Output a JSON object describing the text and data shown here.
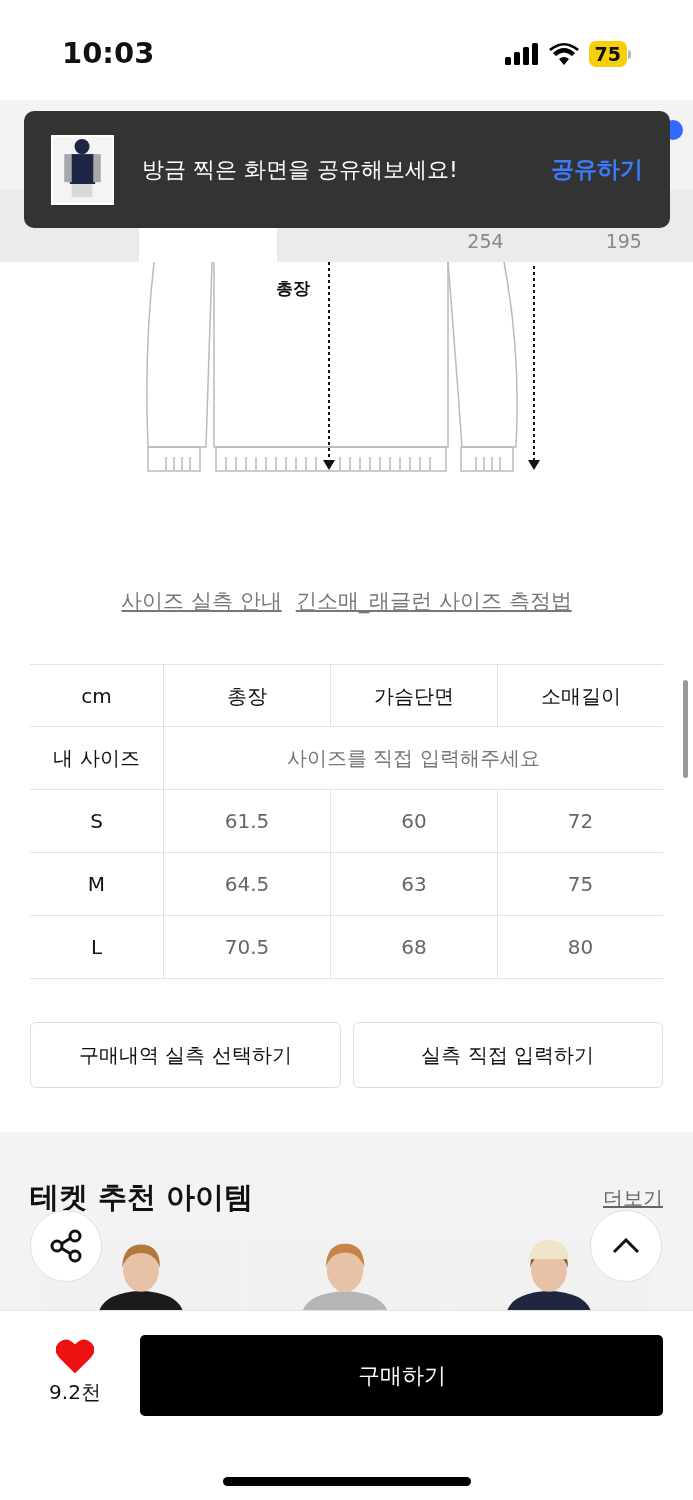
{
  "status_bar": {
    "time": "10:03",
    "battery": "75"
  },
  "toast": {
    "message": "방금 찍은 화면을 공유해보세요!",
    "action": "공유하기"
  },
  "tabs": [
    {
      "selected": true
    },
    {
      "selected": false,
      "count": "254"
    },
    {
      "selected": false,
      "count": "195"
    }
  ],
  "diagram": {
    "label": "총장"
  },
  "guide_links": [
    "사이즈 실측 안내",
    "긴소매_래글런 사이즈 측정법"
  ],
  "size_table": {
    "columns": [
      "cm",
      "총장",
      "가슴단면",
      "소매길이"
    ],
    "my_size": {
      "label": "내 사이즈",
      "placeholder": "사이즈를 직접 입력해주세요"
    },
    "rows": [
      [
        "S",
        "61.5",
        "60",
        "72"
      ],
      [
        "M",
        "64.5",
        "63",
        "75"
      ],
      [
        "L",
        "70.5",
        "68",
        "80"
      ]
    ]
  },
  "size_buttons": [
    "구매내역 실측 선택하기",
    "실측 직접 입력하기"
  ],
  "recommend": {
    "title": "테켓 추천 아이템",
    "more": "더보기"
  },
  "bottom_bar": {
    "likes": "9.2천",
    "liked": true,
    "buy": "구매하기"
  }
}
